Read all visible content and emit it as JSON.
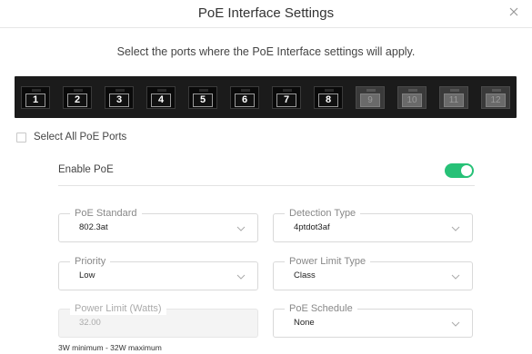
{
  "header": {
    "title": "PoE Interface Settings"
  },
  "subtitle": "Select the ports where the PoE Interface settings will apply.",
  "ports": [
    {
      "label": "1",
      "enabled": true
    },
    {
      "label": "2",
      "enabled": true
    },
    {
      "label": "3",
      "enabled": true
    },
    {
      "label": "4",
      "enabled": true
    },
    {
      "label": "5",
      "enabled": true
    },
    {
      "label": "6",
      "enabled": true
    },
    {
      "label": "7",
      "enabled": true
    },
    {
      "label": "8",
      "enabled": true
    },
    {
      "label": "9",
      "enabled": false
    },
    {
      "label": "10",
      "enabled": false
    },
    {
      "label": "11",
      "enabled": false
    },
    {
      "label": "12",
      "enabled": false
    }
  ],
  "select_all": {
    "label": "Select All PoE Ports",
    "checked": false
  },
  "enable_poe": {
    "label": "Enable PoE",
    "on": true,
    "color": "#27c177"
  },
  "fields": {
    "poe_standard": {
      "label": "PoE Standard",
      "value": "802.3at"
    },
    "detection_type": {
      "label": "Detection Type",
      "value": "4ptdot3af"
    },
    "priority": {
      "label": "Priority",
      "value": "Low"
    },
    "power_limit_type": {
      "label": "Power Limit Type",
      "value": "Class"
    },
    "power_limit": {
      "label": "Power Limit (Watts)",
      "value": "32.00",
      "disabled": true
    },
    "poe_schedule": {
      "label": "PoE Schedule",
      "value": "None"
    }
  },
  "power_limit_hint": "3W minimum - 32W maximum"
}
